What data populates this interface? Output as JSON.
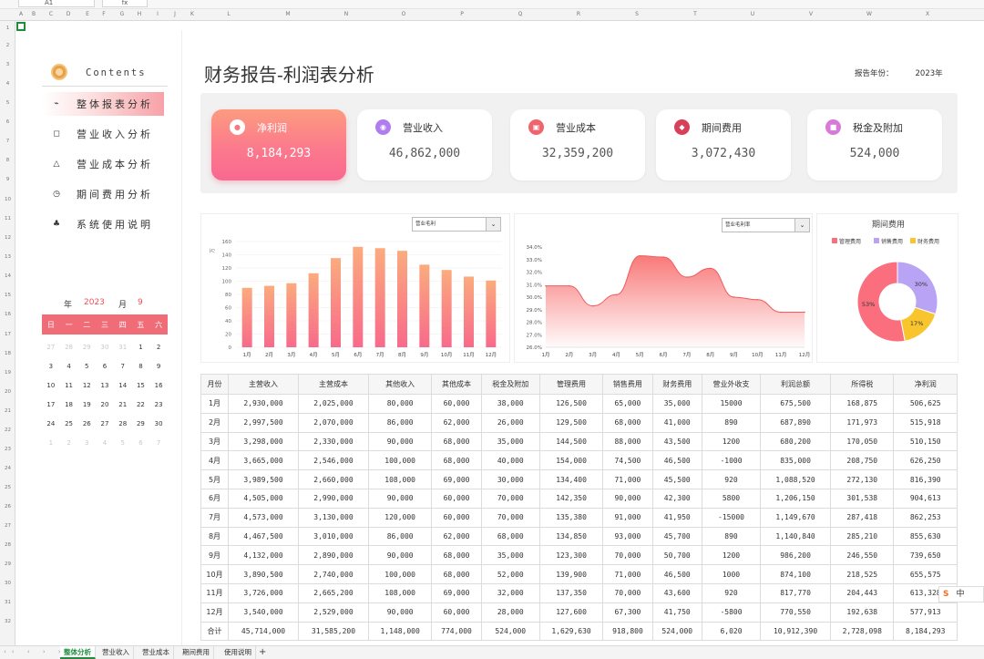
{
  "formula_bar": {
    "cell_ref": "A1",
    "fx_label": "fx"
  },
  "columns": [
    "A",
    "B",
    "C",
    "D",
    "E",
    "F",
    "G",
    "H",
    "I",
    "J",
    "K",
    "L",
    "M",
    "N",
    "O",
    "P",
    "Q",
    "R",
    "S",
    "T",
    "U",
    "V",
    "W",
    "X"
  ],
  "rows": [
    "1",
    "2",
    "3",
    "4",
    "5",
    "6",
    "7",
    "8",
    "9",
    "10",
    "11",
    "12",
    "13",
    "14",
    "15",
    "16",
    "17",
    "18",
    "19",
    "20",
    "21",
    "22",
    "23",
    "24",
    "25",
    "26",
    "27",
    "28",
    "29",
    "30",
    "31",
    "32"
  ],
  "sidebar": {
    "contents_label": "Contents",
    "items": [
      {
        "label": "整体报表分析",
        "icon": "trend-icon",
        "glyph": "⌁"
      },
      {
        "label": "营业收入分析",
        "icon": "square-icon",
        "glyph": "◻"
      },
      {
        "label": "营业成本分析",
        "icon": "triangle-icon",
        "glyph": "△"
      },
      {
        "label": "期间费用分析",
        "icon": "clock-icon",
        "glyph": "◷"
      },
      {
        "label": "系统使用说明",
        "icon": "users-icon",
        "glyph": "♣"
      }
    ]
  },
  "calendar": {
    "year_label": "年",
    "year": "2023",
    "month_label": "月",
    "month": "9",
    "weekdays": [
      "日",
      "一",
      "二",
      "三",
      "四",
      "五",
      "六"
    ],
    "days": [
      {
        "d": "27",
        "dim": true
      },
      {
        "d": "28",
        "dim": true
      },
      {
        "d": "29",
        "dim": true
      },
      {
        "d": "30",
        "dim": true
      },
      {
        "d": "31",
        "dim": true
      },
      {
        "d": "1"
      },
      {
        "d": "2"
      },
      {
        "d": "3"
      },
      {
        "d": "4"
      },
      {
        "d": "5"
      },
      {
        "d": "6"
      },
      {
        "d": "7"
      },
      {
        "d": "8"
      },
      {
        "d": "9"
      },
      {
        "d": "10"
      },
      {
        "d": "11"
      },
      {
        "d": "12"
      },
      {
        "d": "13"
      },
      {
        "d": "14"
      },
      {
        "d": "15"
      },
      {
        "d": "16"
      },
      {
        "d": "17"
      },
      {
        "d": "18"
      },
      {
        "d": "19"
      },
      {
        "d": "20"
      },
      {
        "d": "21"
      },
      {
        "d": "22"
      },
      {
        "d": "23"
      },
      {
        "d": "24"
      },
      {
        "d": "25"
      },
      {
        "d": "26"
      },
      {
        "d": "27"
      },
      {
        "d": "28"
      },
      {
        "d": "29"
      },
      {
        "d": "30"
      },
      {
        "d": "1",
        "dim": true
      },
      {
        "d": "2",
        "dim": true
      },
      {
        "d": "3",
        "dim": true
      },
      {
        "d": "4",
        "dim": true
      },
      {
        "d": "5",
        "dim": true
      },
      {
        "d": "6",
        "dim": true
      },
      {
        "d": "7",
        "dim": true
      }
    ]
  },
  "header": {
    "title": "财务报告-利润表分析",
    "year_label": "报告年份：",
    "year_value": "2023年"
  },
  "kpis": [
    {
      "label": "净利润",
      "value": "8,184,293",
      "icon": "drop-icon",
      "glyph": "●",
      "color": "#f77a7a"
    },
    {
      "label": "营业收入",
      "value": "46,862,000",
      "icon": "bag-icon",
      "glyph": "◉",
      "color": "#b07cf0"
    },
    {
      "label": "营业成本",
      "value": "32,359,200",
      "icon": "cost-icon",
      "glyph": "▣",
      "color": "#f0646e"
    },
    {
      "label": "期间费用",
      "value": "3,072,430",
      "icon": "people-icon",
      "glyph": "◆",
      "color": "#d8405a"
    },
    {
      "label": "税金及附加",
      "value": "524,000",
      "icon": "tax-icon",
      "glyph": "■",
      "color": "#d87ad8"
    }
  ],
  "bar_dropdown": "营业毛利",
  "area_dropdown": "营业毛利率",
  "pie_title": "期间费用",
  "chart_data": [
    {
      "type": "bar",
      "ylabel": "万",
      "categories": [
        "1月",
        "2月",
        "3月",
        "4月",
        "5月",
        "6月",
        "7月",
        "8月",
        "9月",
        "10月",
        "11月",
        "12月"
      ],
      "values": [
        90,
        93,
        97,
        112,
        135,
        152,
        150,
        146,
        125,
        117,
        107,
        101
      ],
      "ylim": [
        0,
        160
      ],
      "yticks": [
        "0",
        "20",
        "40",
        "60",
        "80",
        "100",
        "120",
        "140",
        "160"
      ],
      "colors": {
        "top": "#fbab7e",
        "bottom": "#f86a8a"
      }
    },
    {
      "type": "area",
      "categories": [
        "1月",
        "2月",
        "3月",
        "4月",
        "5月",
        "6月",
        "7月",
        "8月",
        "9月",
        "10月",
        "11月",
        "12月"
      ],
      "values": [
        30.9,
        30.9,
        29.3,
        30.2,
        33.3,
        33.2,
        31.6,
        32.3,
        30.0,
        29.8,
        28.8,
        28.8
      ],
      "ylim": [
        26.0,
        34.0
      ],
      "yticks": [
        "26.0%",
        "27.0%",
        "28.0%",
        "29.0%",
        "30.0%",
        "31.0%",
        "32.0%",
        "33.0%",
        "34.0%"
      ],
      "colors": {
        "line": "#f25c5c",
        "fill": "#f86a6a"
      }
    },
    {
      "type": "pie",
      "legend": [
        "管理费用",
        "销售费用",
        "财务费用"
      ],
      "values": [
        53,
        30,
        17
      ],
      "labels": [
        "53%",
        "30%",
        "17%"
      ],
      "colors": [
        "#fa6e7e",
        "#b8a3f5",
        "#f9c52e"
      ]
    }
  ],
  "table": {
    "headers": [
      "月份",
      "主营收入",
      "主营成本",
      "其他收入",
      "其他成本",
      "税金及附加",
      "管理费用",
      "销售费用",
      "财务费用",
      "营业外收支",
      "利润总额",
      "所得税",
      "净利润"
    ],
    "rows": [
      [
        "1月",
        "2,930,000",
        "2,025,000",
        "80,000",
        "60,000",
        "38,000",
        "126,500",
        "65,000",
        "35,000",
        "15000",
        "675,500",
        "168,875",
        "506,625"
      ],
      [
        "2月",
        "2,997,500",
        "2,070,000",
        "86,000",
        "62,000",
        "26,000",
        "129,500",
        "68,000",
        "41,000",
        "890",
        "687,890",
        "171,973",
        "515,918"
      ],
      [
        "3月",
        "3,298,000",
        "2,330,000",
        "90,000",
        "68,000",
        "35,000",
        "144,500",
        "88,000",
        "43,500",
        "1200",
        "680,200",
        "170,050",
        "510,150"
      ],
      [
        "4月",
        "3,665,000",
        "2,546,000",
        "100,000",
        "68,000",
        "40,000",
        "154,000",
        "74,500",
        "46,500",
        "-1000",
        "835,000",
        "208,750",
        "626,250"
      ],
      [
        "5月",
        "3,989,500",
        "2,660,000",
        "108,000",
        "69,000",
        "30,000",
        "134,400",
        "71,000",
        "45,500",
        "920",
        "1,088,520",
        "272,130",
        "816,390"
      ],
      [
        "6月",
        "4,505,000",
        "2,990,000",
        "90,000",
        "60,000",
        "70,000",
        "142,350",
        "90,000",
        "42,300",
        "5800",
        "1,206,150",
        "301,538",
        "904,613"
      ],
      [
        "7月",
        "4,573,000",
        "3,130,000",
        "120,000",
        "60,000",
        "70,000",
        "135,380",
        "91,000",
        "41,950",
        "-15000",
        "1,149,670",
        "287,418",
        "862,253"
      ],
      [
        "8月",
        "4,467,500",
        "3,010,000",
        "86,000",
        "62,000",
        "68,000",
        "134,850",
        "93,000",
        "45,700",
        "890",
        "1,140,840",
        "285,210",
        "855,630"
      ],
      [
        "9月",
        "4,132,000",
        "2,890,000",
        "90,000",
        "68,000",
        "35,000",
        "123,300",
        "70,000",
        "50,700",
        "1200",
        "986,200",
        "246,550",
        "739,650"
      ],
      [
        "10月",
        "3,890,500",
        "2,740,000",
        "100,000",
        "68,000",
        "52,000",
        "139,900",
        "71,000",
        "46,500",
        "1000",
        "874,100",
        "218,525",
        "655,575"
      ],
      [
        "11月",
        "3,726,000",
        "2,665,200",
        "108,000",
        "69,000",
        "32,000",
        "137,350",
        "70,000",
        "43,600",
        "920",
        "817,770",
        "204,443",
        "613,328"
      ],
      [
        "12月",
        "3,540,000",
        "2,529,000",
        "90,000",
        "60,000",
        "28,000",
        "127,600",
        "67,300",
        "41,750",
        "-5800",
        "770,550",
        "192,638",
        "577,913"
      ],
      [
        "合计",
        "45,714,000",
        "31,585,200",
        "1,148,000",
        "774,000",
        "524,000",
        "1,629,630",
        "918,800",
        "524,000",
        "6,020",
        "10,912,390",
        "2,728,098",
        "8,184,293"
      ]
    ]
  },
  "sheet_tabs": [
    "整体分析",
    "营业收入",
    "营业成本",
    "期间费用",
    "使用说明"
  ],
  "sheet_add": "+",
  "ime": {
    "logo": "S",
    "lang": "中"
  }
}
